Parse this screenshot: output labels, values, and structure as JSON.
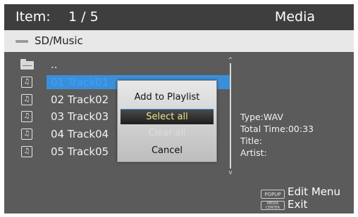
{
  "header": {
    "item_label": "Item:",
    "item_count": "1 / 5",
    "section": "Media"
  },
  "path": {
    "icon": "folder-icon",
    "text": "SD/Music"
  },
  "files": [
    {
      "label": "..",
      "icon": "folder-up-icon"
    },
    {
      "label": "01 Track01",
      "icon": "music-note-icon",
      "selected": true
    },
    {
      "label": "02 Track02",
      "icon": "music-note-icon"
    },
    {
      "label": "03 Track03",
      "icon": "music-note-icon"
    },
    {
      "label": "04 Track04",
      "icon": "music-note-icon"
    },
    {
      "label": "05 Track05",
      "icon": "music-note-icon"
    }
  ],
  "info": {
    "type": "Type:WAV",
    "total_time": "Total Time:00:33",
    "title": "Title:",
    "artist": "Artist:"
  },
  "popup_menu": {
    "items": [
      {
        "label": "Add to Playlist",
        "state": "normal"
      },
      {
        "label": "Select all",
        "state": "active"
      },
      {
        "label": "Clear all",
        "state": "disabled"
      },
      {
        "label": "Cancel",
        "state": "normal"
      }
    ]
  },
  "hints": {
    "popup_key": "POPUP",
    "popup_action": "Edit Menu",
    "media_key": "MEDIA CENTER",
    "media_action": "Exit"
  },
  "colors": {
    "selection": "#3b8fd9",
    "selected_text": "#3aa0ff",
    "active_menu_text": "#f0e68c"
  }
}
